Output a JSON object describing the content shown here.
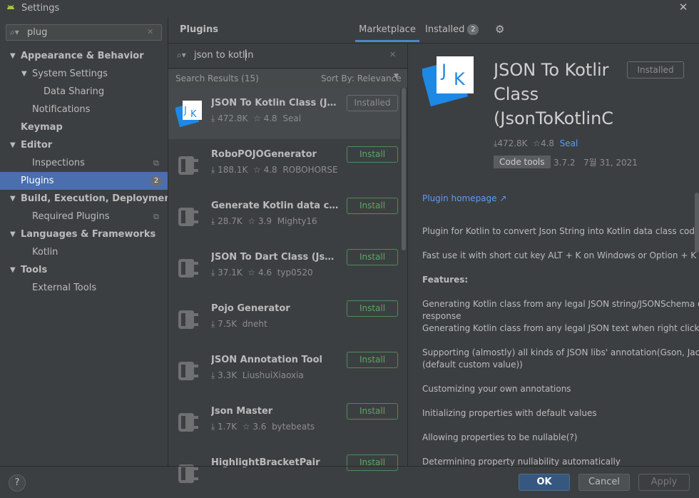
{
  "window": {
    "title": "Settings"
  },
  "sidebar": {
    "search_value": "plug",
    "items": [
      {
        "label": "Appearance & Behavior",
        "level": 0,
        "bold": true,
        "expanded": true
      },
      {
        "label": "System Settings",
        "level": 1,
        "bold": false,
        "expanded": true
      },
      {
        "label": "Data Sharing",
        "level": 2,
        "bold": false
      },
      {
        "label": "Notifications",
        "level": 1,
        "bold": false
      },
      {
        "label": "Keymap",
        "level": 0,
        "bold": true
      },
      {
        "label": "Editor",
        "level": 0,
        "bold": true,
        "expanded": true
      },
      {
        "label": "Inspections",
        "level": 1,
        "bold": false,
        "icon": "copy-icon"
      },
      {
        "label": "Plugins",
        "level": 0,
        "bold": false,
        "selected": true,
        "badge": "2"
      },
      {
        "label": "Build, Execution, Deployment",
        "level": 0,
        "bold": true,
        "expanded": true
      },
      {
        "label": "Required Plugins",
        "level": 1,
        "bold": false,
        "icon": "copy-icon"
      },
      {
        "label": "Languages & Frameworks",
        "level": 0,
        "bold": true,
        "expanded": true
      },
      {
        "label": "Kotlin",
        "level": 1,
        "bold": false
      },
      {
        "label": "Tools",
        "level": 0,
        "bold": true,
        "expanded": true
      },
      {
        "label": "External Tools",
        "level": 1,
        "bold": false
      }
    ]
  },
  "header": {
    "title": "Plugins",
    "tab_marketplace": "Marketplace",
    "tab_installed": "Installed",
    "installed_count": "2"
  },
  "results": {
    "search_value": "json to kotlin",
    "count_label": "Search Results (15)",
    "sort_label": "Sort By: Relevance",
    "plugins": [
      {
        "name": "JSON To Kotlin Class (JsonTo...",
        "downloads": "472.8K",
        "rating": "4.8",
        "vendor": "Seal",
        "button": "Installed",
        "installed": true,
        "icon": "jk-logo"
      },
      {
        "name": "RoboPOJOGenerator",
        "downloads": "188.1K",
        "rating": "4.8",
        "vendor": "ROBOHORSE",
        "button": "Install",
        "installed": false,
        "icon": "plugin-plug-icon"
      },
      {
        "name": "Generate Kotlin data classes...",
        "downloads": "28.7K",
        "rating": "3.9",
        "vendor": "Mighty16",
        "button": "Install",
        "installed": false,
        "icon": "plugin-plug-icon"
      },
      {
        "name": "JSON To Dart Class (JsonToD...",
        "downloads": "37.1K",
        "rating": "4.6",
        "vendor": "typ0520",
        "button": "Install",
        "installed": false,
        "icon": "plugin-plug-icon"
      },
      {
        "name": "Pojo Generator",
        "downloads": "7.5K",
        "rating": "",
        "vendor": "dneht",
        "button": "Install",
        "installed": false,
        "icon": "plugin-plug-icon"
      },
      {
        "name": "JSON Annotation Tool",
        "downloads": "3.3K",
        "rating": "",
        "vendor": "LiushuiXiaoxia",
        "button": "Install",
        "installed": false,
        "icon": "plugin-plug-icon"
      },
      {
        "name": "Json Master",
        "downloads": "1.7K",
        "rating": "3.6",
        "vendor": "bytebeats",
        "button": "Install",
        "installed": false,
        "icon": "plugin-plug-icon"
      },
      {
        "name": "HighlightBracketPair",
        "downloads": "",
        "rating": "",
        "vendor": "",
        "button": "Install",
        "installed": false,
        "icon": "plugin-plug-icon"
      }
    ]
  },
  "detail": {
    "logo_text": "JK",
    "title": "JSON To Kotlir\nClass\n(JsonToKotlinC",
    "installed_label": "Installed",
    "downloads": "472.8K",
    "rating": "4.8",
    "vendor": "Seal",
    "tag": "Code tools",
    "version": "3.7.2",
    "date": "7월 31, 2021",
    "homepage": "Plugin homepage ↗",
    "desc1": "Plugin for Kotlin to convert Json String into Kotlin data class code quick",
    "desc2": "Fast use it with short cut key ALT + K on Windows or Option + K on Ma",
    "features_title": "Features:",
    "f1a": "Generating Kotlin class from any legal JSON string/JSONSchema or any",
    "f1b": "response",
    "f2": "Generating Kotlin class from any legal JSON text when right click on dir",
    "f3a": "Supporting (almostly) all kinds of JSON libs' annotation(Gson, Jackson, F",
    "f3b": "(default custom value))",
    "f4": "Customizing your own annotations",
    "f5": "Initializing properties with default values",
    "f6": "Allowing properties to be nullable(?)",
    "f7": "Determining property nullability automatically"
  },
  "footer": {
    "help": "?",
    "ok": "OK",
    "cancel": "Cancel",
    "apply": "Apply"
  },
  "colors": {
    "accent": "#4b6eaf",
    "install_green": "#5ca566",
    "link": "#589df6",
    "logo_blue": "#1e88e5"
  }
}
